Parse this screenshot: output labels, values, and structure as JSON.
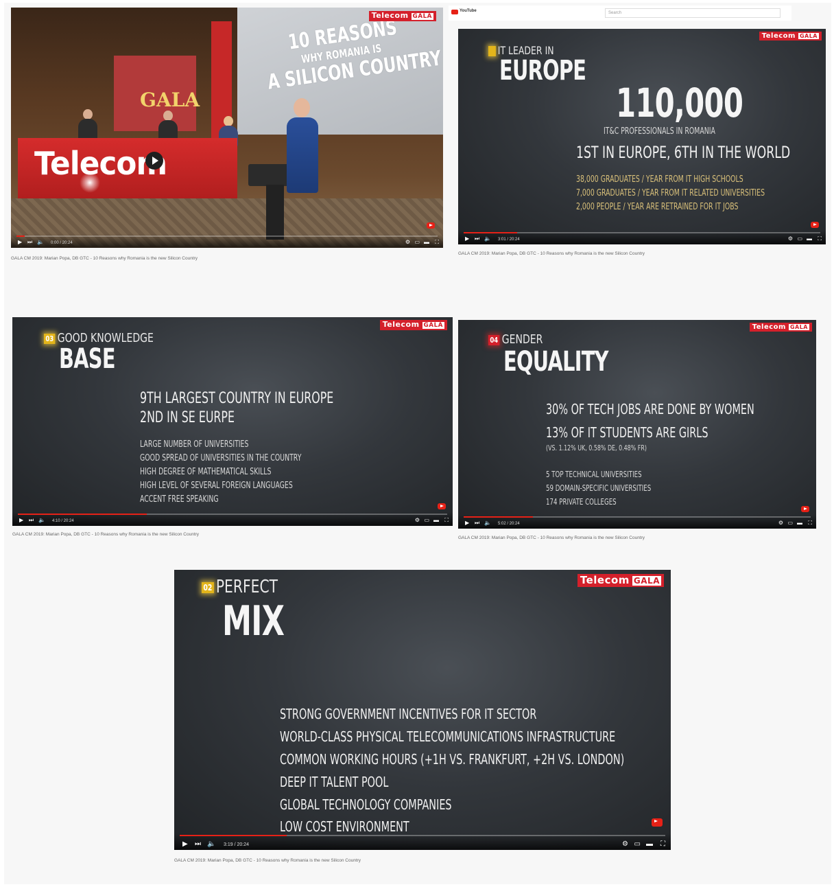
{
  "brand": {
    "logo_text": "Telecom",
    "logo_badge": "GALA"
  },
  "youtube_bar": {
    "logo_label": "YouTube",
    "search_placeholder": "Search"
  },
  "videos": [
    {
      "id": "photo",
      "screen_lines": [
        "10 REASONS",
        "WHY ROMANIA IS",
        "A SILICON COUNTRY"
      ],
      "banner_text": "Telecom",
      "stage_sign": "GALA",
      "time": "0:00 / 20:24",
      "progress": 0.02,
      "caption": "GALA CM 2019: Marian Popa, DB GTC - 10 Reasons why Romania is the new Silicon Country"
    },
    {
      "id": "it-leader",
      "kicker": "IT LEADER IN",
      "headline": "EUROPE",
      "big_number": "110,000",
      "sub": "IT&C PROFESSIONALS IN ROMANIA",
      "rank": "1ST IN EUROPE, 6TH IN THE WORLD",
      "bullets": [
        "38,000 GRADUATES / YEAR FROM IT HIGH SCHOOLS",
        "7,000 GRADUATES / YEAR FROM IT RELATED UNIVERSITIES",
        "2,000 PEOPLE / YEAR ARE RETRAINED FOR IT JOBS"
      ],
      "time": "3:01 / 20:24",
      "progress": 0.15,
      "caption": "GALA CM 2019: Marian Popa, DB GTC - 10 Reasons why Romania is the new Silicon Country"
    },
    {
      "id": "knowledge",
      "badge": "03",
      "kicker": "GOOD KNOWLEDGE",
      "headline": "BASE",
      "lines": [
        "9TH LARGEST COUNTRY IN EUROPE",
        "2ND IN SE EURPE"
      ],
      "bullets": [
        "LARGE NUMBER OF UNIVERSITIES",
        "GOOD SPREAD OF UNIVERSITIES IN THE COUNTRY",
        "HIGH DEGREE OF MATHEMATICAL SKILLS",
        "HIGH LEVEL OF SEVERAL FOREIGN LANGUAGES",
        "ACCENT FREE SPEAKING"
      ],
      "time": "4:10 / 20:24",
      "progress": 0.3,
      "caption": "GALA CM 2019: Marian Popa, DB GTC - 10 Reasons why Romania is the new Silicon Country"
    },
    {
      "id": "gender",
      "badge": "04",
      "kicker": "GENDER",
      "headline": "EQUALITY",
      "lines": [
        "30% OF TECH JOBS ARE DONE BY WOMEN",
        "13% OF IT STUDENTS ARE GIRLS"
      ],
      "note": "(VS. 1.12% UK, 0.58% DE, 0.48% FR)",
      "bullets": [
        "5 TOP TECHNICAL UNIVERSITIES",
        "59 DOMAIN-SPECIFIC UNIVERSITIES",
        "174 PRIVATE COLLEGES"
      ],
      "time": "5:02 / 20:24",
      "progress": 0.2,
      "caption": "GALA CM 2019: Marian Popa, DB GTC - 10 Reasons why Romania is the new Silicon Country"
    },
    {
      "id": "mix",
      "badge": "02",
      "kicker": "PERFECT",
      "headline": "MIX",
      "bullets": [
        "STRONG GOVERNMENT INCENTIVES FOR IT SECTOR",
        "WORLD-CLASS PHYSICAL TELECOMMUNICATIONS INFRASTRUCTURE",
        "COMMON WORKING HOURS (+1H VS. FRANKFURT, +2H VS. LONDON)",
        "DEEP IT TALENT POOL",
        "GLOBAL TECHNOLOGY COMPANIES",
        "LOW COST ENVIRONMENT"
      ],
      "time": "3:19 / 20:24",
      "progress": 0.22,
      "caption": "GALA CM 2019: Marian Popa, DB GTC - 10 Reasons why Romania is the new Silicon Country"
    }
  ]
}
